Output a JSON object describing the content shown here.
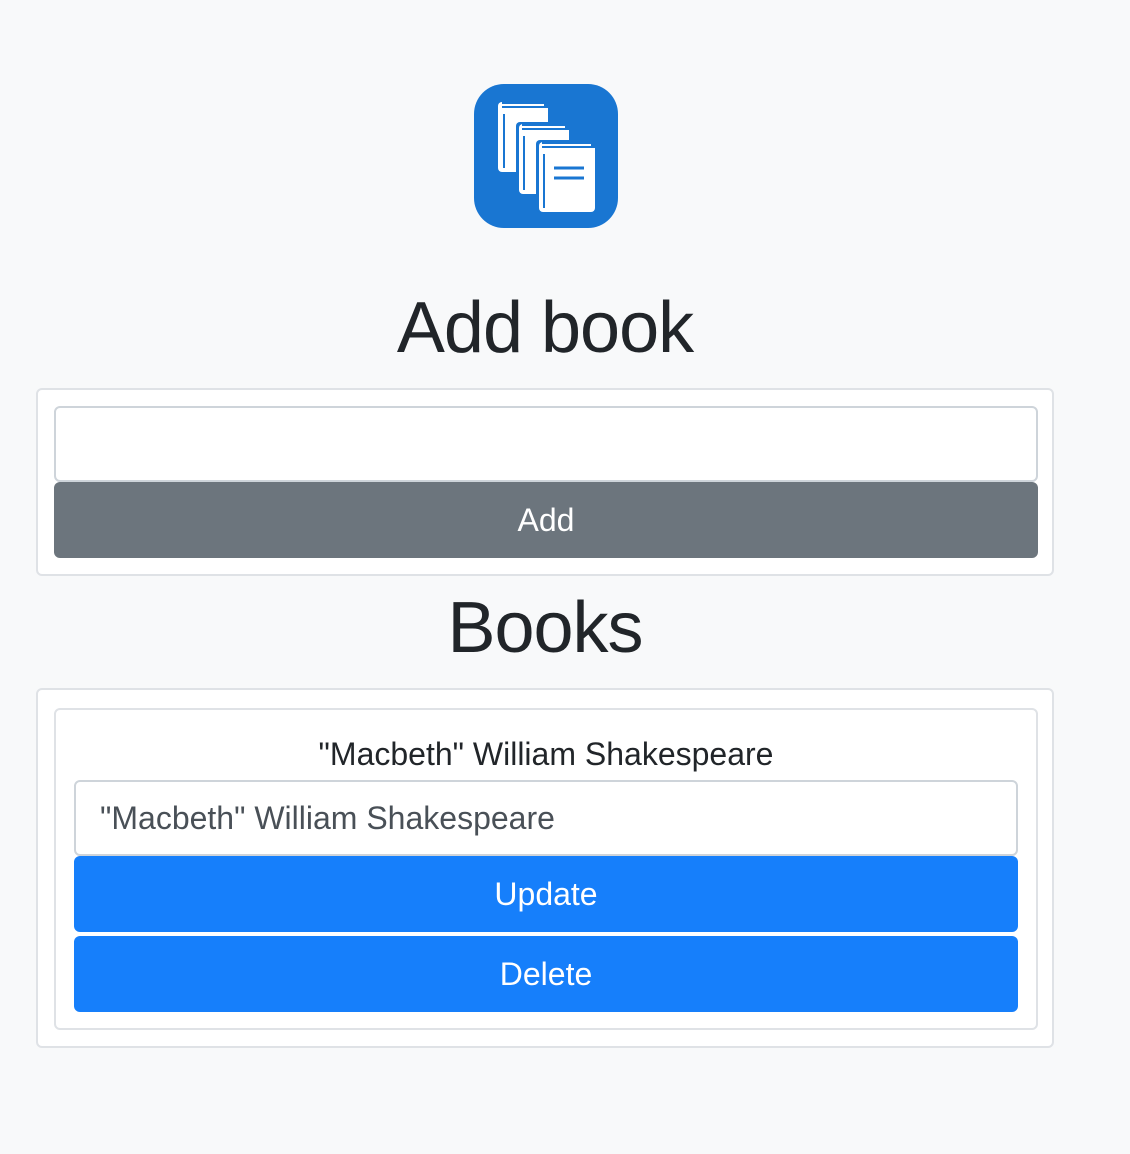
{
  "app": {
    "logo_icon": "books-stack-icon",
    "brand_color": "#1976d2"
  },
  "add_section": {
    "heading": "Add book",
    "input_value": "",
    "input_placeholder": "",
    "add_label": "Add"
  },
  "books_section": {
    "heading": "Books",
    "items": [
      {
        "title": "\"Macbeth\" William Shakespeare",
        "edit_value": "\"Macbeth\" William Shakespeare",
        "update_label": "Update",
        "delete_label": "Delete"
      }
    ]
  },
  "colors": {
    "primary": "#167ffb",
    "secondary": "#6c757d",
    "background": "#f8f9fa"
  }
}
